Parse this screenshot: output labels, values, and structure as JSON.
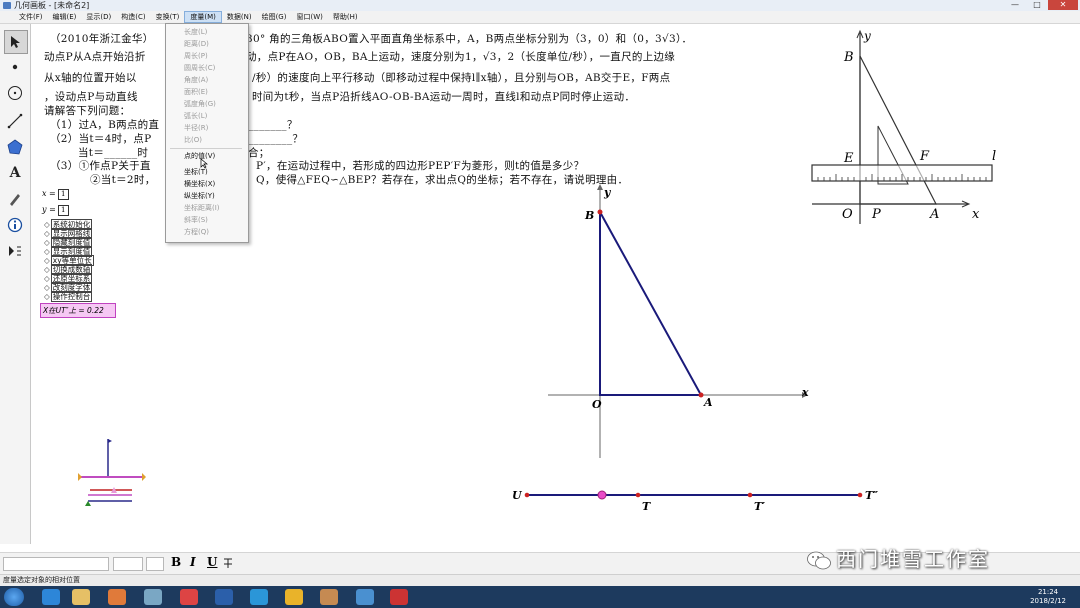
{
  "window": {
    "title": "几何画板 - [未命名2]",
    "min": "—",
    "max": "□",
    "close": "✕"
  },
  "menu": [
    "文件(F)",
    "编辑(E)",
    "显示(D)",
    "构造(C)",
    "变换(T)",
    "度量(M)",
    "数据(N)",
    "绘图(G)",
    "窗口(W)",
    "帮助(H)"
  ],
  "dropdown": {
    "disabled_top": [
      "长度(L)",
      "距离(D)",
      "周长(P)",
      "圆周长(C)",
      "角度(A)",
      "面积(E)",
      "弧度角(G)",
      "弧长(L)",
      "半径(R)",
      "比(O)"
    ],
    "enabled": [
      "点的值(V)",
      "坐标(T)",
      "横坐标(X)",
      "纵坐标(Y)"
    ],
    "disabled_bottom": [
      "坐标距离(I)",
      "斜率(S)",
      "方程(Q)"
    ]
  },
  "problem": {
    "line1a": "（2010年浙江金华）",
    "line1b": "30°  角的三角板ABO置入平面直角坐标系中，A，B两点坐标分别为（3，0）和（0，3√3）．",
    "line2a": "动点P从A点开始沿折",
    "line2b": "动，点P在AO，OB，BA上运动，速度分别为1，√3，2（长度单位/秒），一直尺的上边缘",
    "line3a": "从x轴的位置开始以",
    "line3b": "/秒）的速度向上平行移动（即移动过程中保持l∥x轴），且分别与OB，AB交于E，F两点",
    "line4a": "，设动点P与动直线",
    "line4b": "时间为t秒，当点P沿折线AO-OB-BA运动一周时，直线l和动点P同时停止运动．",
    "line5": "请解答下列问题：",
    "q1a": "（1）过A，B两点的直",
    "q1b": "_______？",
    "q2a": "（2）当t＝4时，点P",
    "q2b": "________？",
    "q2c": "当t＝______时",
    "q2d": "合；",
    "q3a": "（3）①作点P关于直",
    "q3b": "P′，在运动过程中，若形成的四边形PEP′F为菱形，则t的值是多少？",
    "q3c": "②当t＝2时，",
    "q3d": "Q，使得△FEQ∽△BEP？若存在，求出点Q的坐标；若不存在，请说明理由．"
  },
  "params": {
    "x_label": "x =",
    "x_value": "1",
    "y_label": "y =",
    "y_value": "1"
  },
  "action_buttons": [
    "系统初始化",
    "显示网格线",
    "隐藏刻度值",
    "显示刻度值",
    "xy等单位长",
    "切换成数轴",
    "还原坐标系",
    "改刻度字体",
    "操作控制台"
  ],
  "measurement": "X在UT″上 = 0.22",
  "graph_labels": {
    "B": "B",
    "O": "O",
    "A": "A",
    "x": "x",
    "y": "y"
  },
  "slider_labels": {
    "U": "U",
    "T": "T",
    "T1": "T′",
    "T2": "T″"
  },
  "figure_labels": {
    "y": "y",
    "B": "B",
    "E": "E",
    "F": "F",
    "l": "l",
    "O": "O",
    "P": "P",
    "A": "A",
    "x": "x"
  },
  "format_bar": {
    "bold": "B",
    "italic": "I",
    "underline": "U"
  },
  "status": "度量选定对象的相对位置",
  "clock": {
    "time": "21:24",
    "date": "2018/2/12"
  },
  "watermark": "西门堆雪工作室"
}
